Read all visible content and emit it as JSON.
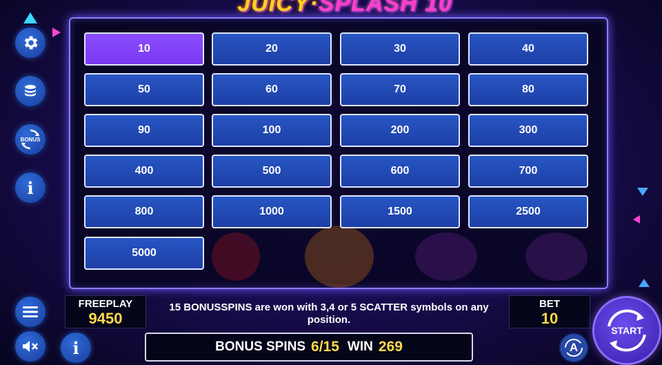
{
  "header": {
    "title_part1": "JUICY",
    "title_sep": "·",
    "title_part2": "SPLASH 10"
  },
  "bet_options": [
    {
      "label": "10",
      "selected": true
    },
    {
      "label": "20",
      "selected": false
    },
    {
      "label": "30",
      "selected": false
    },
    {
      "label": "40",
      "selected": false
    },
    {
      "label": "50",
      "selected": false
    },
    {
      "label": "60",
      "selected": false
    },
    {
      "label": "70",
      "selected": false
    },
    {
      "label": "80",
      "selected": false
    },
    {
      "label": "90",
      "selected": false
    },
    {
      "label": "100",
      "selected": false
    },
    {
      "label": "200",
      "selected": false
    },
    {
      "label": "300",
      "selected": false
    },
    {
      "label": "400",
      "selected": false
    },
    {
      "label": "500",
      "selected": false
    },
    {
      "label": "600",
      "selected": false
    },
    {
      "label": "700",
      "selected": false
    },
    {
      "label": "800",
      "selected": false
    },
    {
      "label": "1000",
      "selected": false
    },
    {
      "label": "1500",
      "selected": false
    },
    {
      "label": "2500",
      "selected": false
    },
    {
      "label": "5000",
      "selected": false
    }
  ],
  "sidebar": {
    "settings_icon": "gear-icon",
    "bet_icon": "coin-stack-icon",
    "bonus_label": "BONUS",
    "info_label": "i"
  },
  "footer": {
    "freeplay_label": "FREEPLAY",
    "freeplay_value": "9450",
    "info_message": "15 BONUSSPINS are won with 3,4 or 5 SCATTER symbols on any position.",
    "bet_label": "BET",
    "bet_value": "10",
    "bonus_spins_label": "BONUS SPINS",
    "bonus_spins_value": "6/15",
    "win_label": "WIN",
    "win_value": "269",
    "info_button_label": "i",
    "auto_label": "A",
    "start_label": "START"
  },
  "colors": {
    "button_blue": "#2453c0",
    "button_selected": "#8443fb",
    "value_yellow": "#ffd94a"
  }
}
